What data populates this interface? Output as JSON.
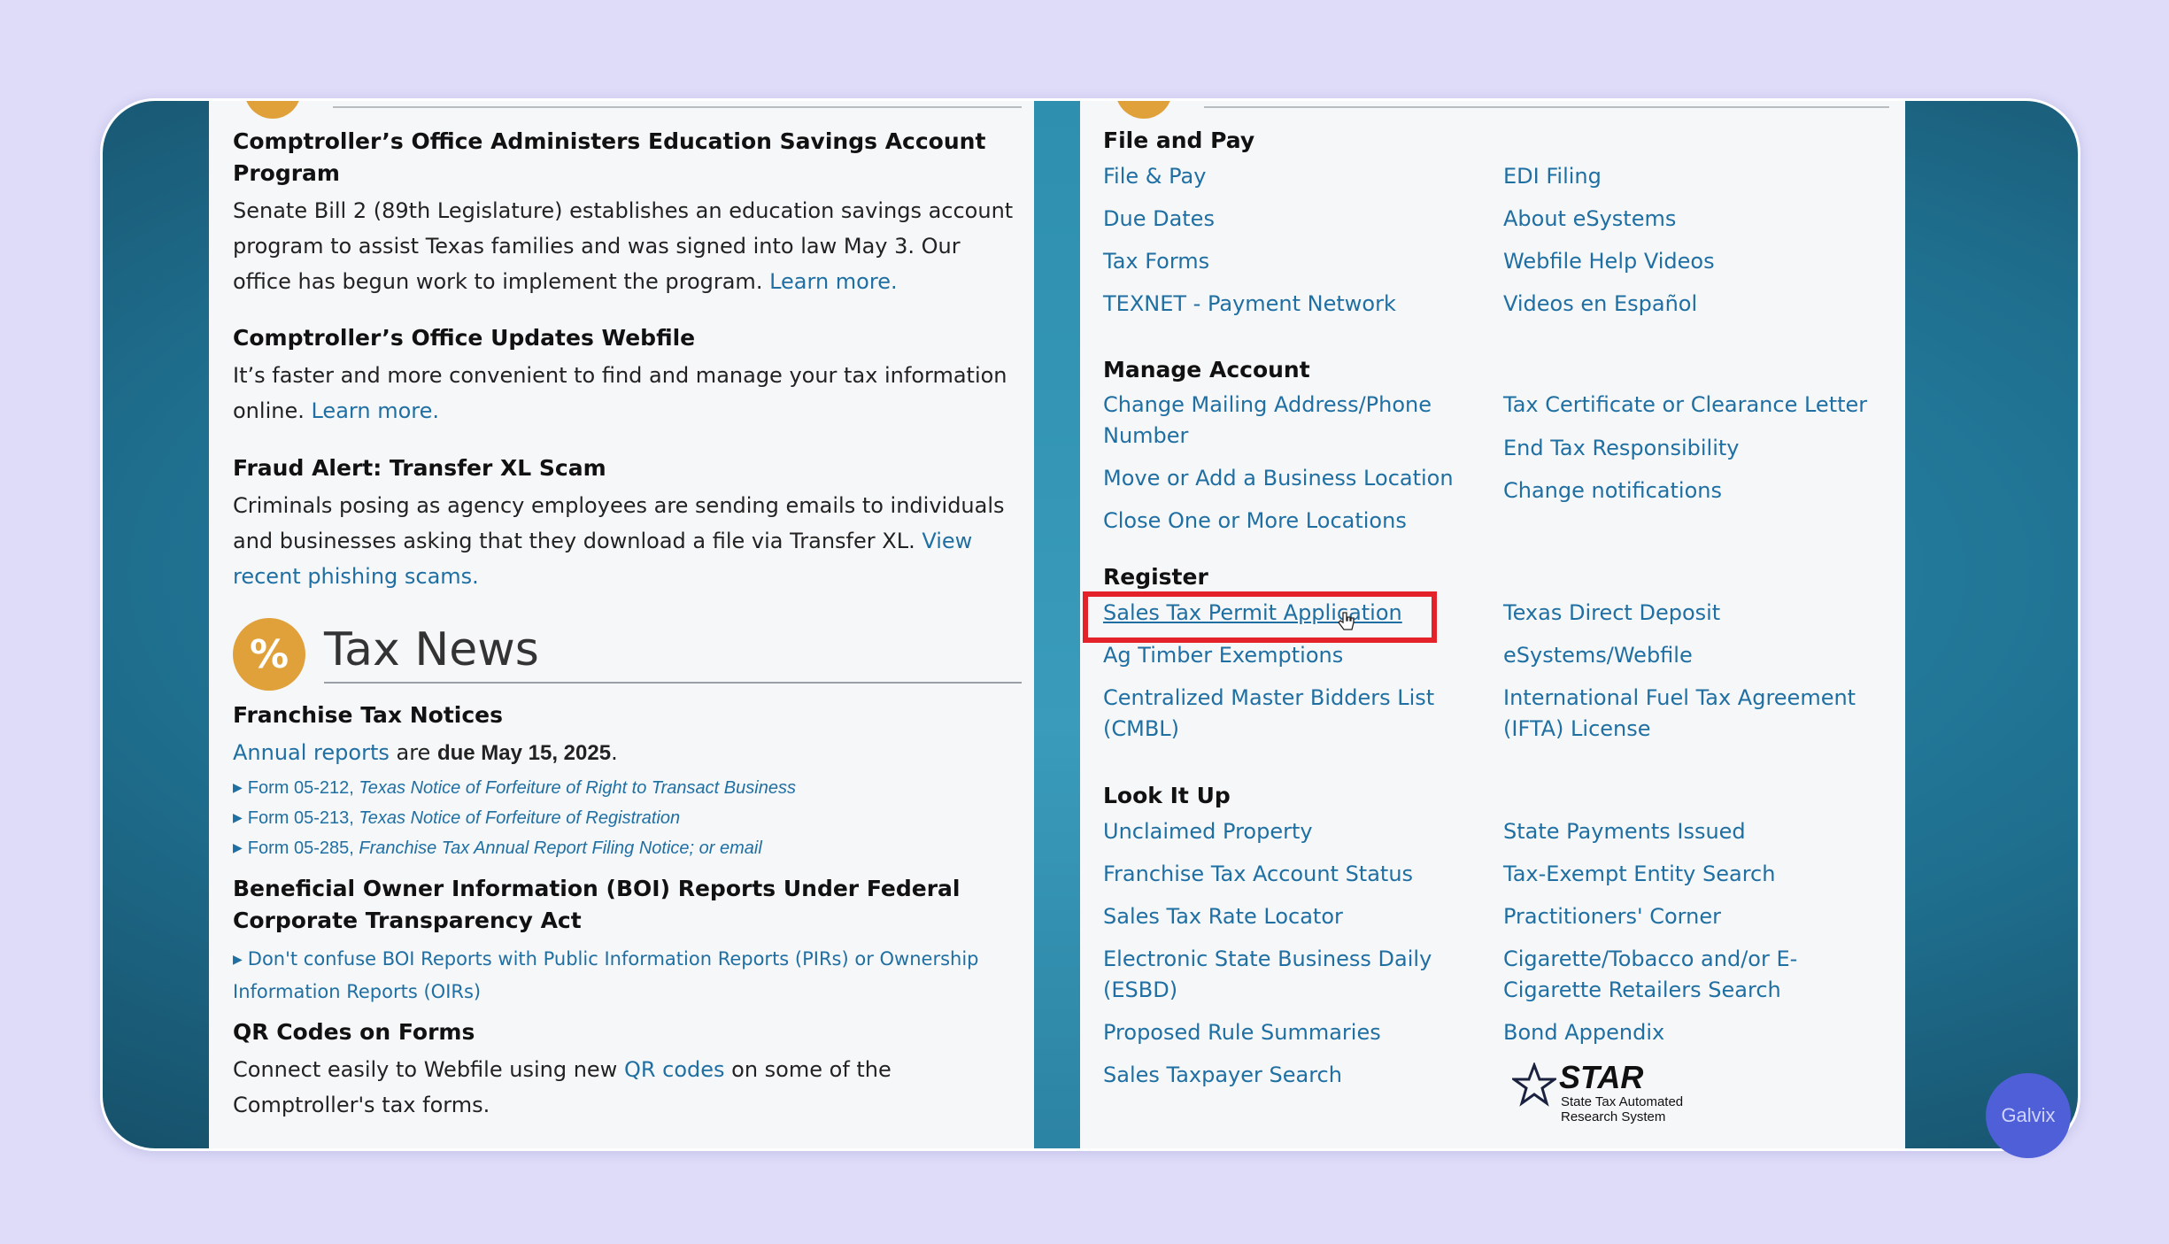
{
  "left": {
    "items": [
      {
        "title": "Comptroller’s Office Administers Education Savings Account Program",
        "text": "Senate Bill 2 (89th Legislature) establishes an education savings account program to assist Texas families and was signed into law May 3. Our office has begun work to implement the program.",
        "link": "Learn more."
      },
      {
        "title": "Comptroller’s Office Updates Webfile",
        "text": "It’s faster and more convenient to find and manage your tax information online.",
        "link": "Learn more."
      },
      {
        "title": "Fraud Alert: Transfer XL Scam",
        "text": "Criminals posing as agency employees are sending emails to individuals and businesses asking that they download a file via Transfer XL.",
        "link": "View recent phishing scams."
      }
    ],
    "tax_news": {
      "icon_glyph": "%",
      "title": "Tax News",
      "franchise": {
        "title": "Franchise Tax Notices",
        "link": "Annual reports",
        "text_mid": " are ",
        "text_bold": "due May 15, 2025",
        "text_end": ".",
        "forms": [
          {
            "num": "Form 05-212, ",
            "name": "Texas Notice of Forfeiture of Right to Transact Business"
          },
          {
            "num": "Form 05-213, ",
            "name": "Texas Notice of Forfeiture of Registration"
          },
          {
            "num": "Form 05-285, ",
            "name": "Franchise Tax Annual Report Filing Notice; or email"
          }
        ]
      },
      "boi": {
        "title": "Beneficial Owner Information (BOI) Reports Under Federal Corporate Transparency Act",
        "link": "Don't confuse BOI Reports with Public Information Reports (PIRs) or Ownership Information Reports (OIRs)"
      },
      "qr": {
        "title": "QR Codes on Forms",
        "text_start": "Connect easily to Webfile using new ",
        "link": "QR codes",
        "text_end": " on some of the Comptroller's tax forms."
      }
    }
  },
  "right": {
    "file_pay": {
      "title": "File and Pay",
      "col1": [
        "File & Pay",
        "Due Dates",
        "Tax Forms",
        "TEXNET - Payment Network"
      ],
      "col2": [
        "EDI Filing",
        "About eSystems",
        "Webfile Help Videos",
        "Videos en Español"
      ]
    },
    "manage": {
      "title": "Manage Account",
      "col1": [
        "Change Mailing Address/Phone Number",
        "Move or Add a Business Location",
        "Close One or More Locations"
      ],
      "col2": [
        "Tax Certificate or Clearance Letter",
        "End Tax Responsibility",
        "Change notifications"
      ]
    },
    "register": {
      "title": "Register",
      "col1": [
        "Sales Tax Permit Application",
        "Ag Timber Exemptions",
        "Centralized Master Bidders List (CMBL)"
      ],
      "col2": [
        "Texas Direct Deposit",
        "eSystems/Webfile",
        "International Fuel Tax Agreement (IFTA) License"
      ]
    },
    "lookup": {
      "title": "Look It Up",
      "col1": [
        "Unclaimed Property",
        "Franchise Tax Account Status",
        "Sales Tax Rate Locator",
        "Electronic State Business Daily (ESBD)",
        "Proposed Rule Summaries",
        "Sales Taxpayer Search"
      ],
      "col2": [
        "State Payments Issued",
        "Tax-Exempt Entity Search",
        "Practitioners' Corner",
        "Cigarette/Tobacco and/or E-Cigarette Retailers Search",
        "Bond Appendix"
      ]
    },
    "star": {
      "word": "STAR",
      "sub1": "State Tax Automated",
      "sub2": "Research System"
    }
  },
  "watermark": "Galvix",
  "colors": {
    "link": "#1f6fa3",
    "highlight": "#e4222a",
    "badge": "#e0a03a",
    "background": "#dedcf8"
  }
}
